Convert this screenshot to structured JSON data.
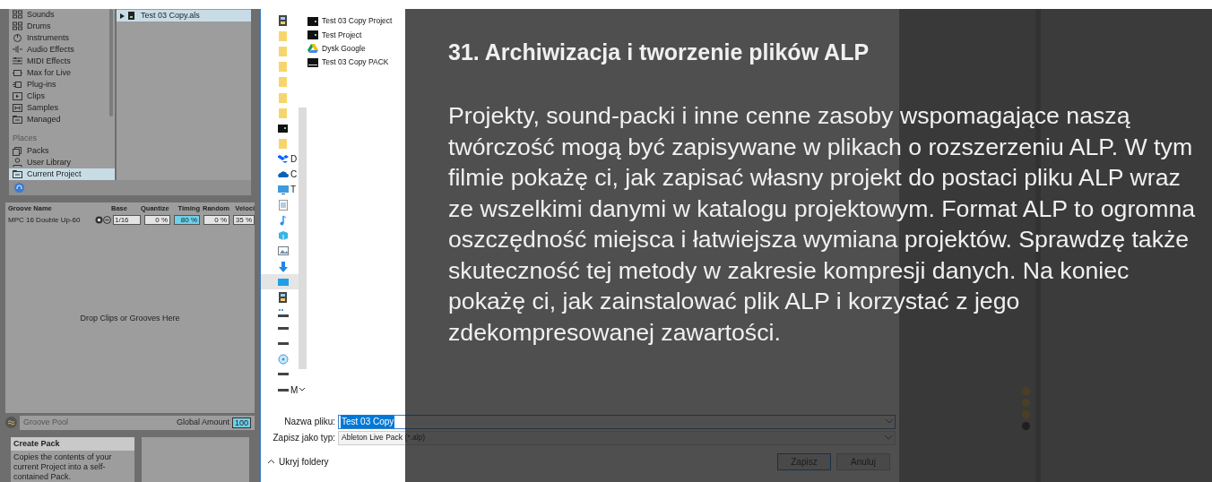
{
  "browser": {
    "categories": [
      {
        "label": "Sounds"
      },
      {
        "label": "Drums"
      },
      {
        "label": "Instruments"
      },
      {
        "label": "Audio Effects"
      },
      {
        "label": "MIDI Effects"
      },
      {
        "label": "Max for Live"
      },
      {
        "label": "Plug-ins"
      },
      {
        "label": "Clips"
      },
      {
        "label": "Samples"
      },
      {
        "label": "Managed"
      }
    ],
    "places_heading": "Places",
    "places": [
      {
        "label": "Packs",
        "selected": false
      },
      {
        "label": "User Library",
        "selected": false
      },
      {
        "label": "Current Project",
        "selected": true
      }
    ],
    "files": [
      {
        "label": "Test 03 Copy.als",
        "selected": true
      }
    ]
  },
  "groove_pool": {
    "columns": [
      "Groove Name",
      "Base",
      "Quantize",
      "Timing",
      "Random",
      "Veloci"
    ],
    "rows": [
      {
        "name": "MPC 16 Double Up-60",
        "base": "1/16",
        "quantize": "0 %",
        "timing": "80 %",
        "random": "0 %",
        "velocity": "35 %"
      }
    ],
    "drop_hint": "Drop Clips or Grooves Here",
    "footer_title": "Groove Pool",
    "global_amount_label": "Global Amount",
    "global_amount": "100"
  },
  "info_view": {
    "title": "Create Pack",
    "text": "Copies the contents of your current Project into a self-contained Pack."
  },
  "save_dialog": {
    "nav_items": [
      {
        "kind": "video",
        "selected": false
      },
      {
        "kind": "folder",
        "selected": false
      },
      {
        "kind": "folder",
        "selected": false
      },
      {
        "kind": "folder",
        "selected": false
      },
      {
        "kind": "folder",
        "selected": false
      },
      {
        "kind": "folder",
        "selected": false
      },
      {
        "kind": "folder",
        "selected": false
      },
      {
        "kind": "project",
        "selected": false
      },
      {
        "kind": "folder",
        "selected": false
      },
      {
        "kind": "dropbox",
        "label": "D",
        "selected": false
      },
      {
        "kind": "cloud",
        "label": "C",
        "selected": false
      },
      {
        "kind": "pc",
        "label": "T",
        "selected": false
      },
      {
        "kind": "document",
        "selected": false
      },
      {
        "kind": "music",
        "selected": false
      },
      {
        "kind": "cube",
        "selected": false
      },
      {
        "kind": "picture",
        "selected": false
      },
      {
        "kind": "download",
        "selected": false
      },
      {
        "kind": "desktop",
        "selected": true
      },
      {
        "kind": "video",
        "selected": false
      },
      {
        "kind": "netdrive",
        "selected": false
      },
      {
        "kind": "drive",
        "selected": false
      },
      {
        "kind": "drive",
        "selected": false
      },
      {
        "kind": "disc",
        "selected": false
      },
      {
        "kind": "drive",
        "selected": false
      },
      {
        "kind": "drive",
        "label": "M",
        "expandable": true,
        "selected": false
      }
    ],
    "files": [
      {
        "name": "Test 03 Copy Project",
        "kind": "project"
      },
      {
        "name": "Test Project",
        "kind": "project"
      },
      {
        "name": "Dysk Google",
        "kind": "gdrive"
      },
      {
        "name": "Test 03 Copy PACK",
        "kind": "pack"
      }
    ],
    "filename_label": "Nazwa pliku:",
    "filename": "Test 03 Copy",
    "filetype_label": "Zapisz jako typ:",
    "filetype": "Ableton Live Pack (*.alp)",
    "hide_folders": "Ukryj foldery",
    "buttons": [
      "Zapisz",
      "Anuluj"
    ]
  },
  "overlay": {
    "title": "31. Archiwizacja i tworzenie plików ALP",
    "description": "Projekty, sound-packi i inne cenne zasoby wspomagające naszą twórczość mogą być zapisywane w plikach o rozszerzeniu ALP. W tym filmie pokażę ci, jak zapisać własny projekt do postaci pliku ALP wraz ze wszelkimi danymi w katalogu projektowym. Format ALP to ogromna oszczędność miejsca i łatwiejsza wymiana projektów. Sprawdzę także skuteczność tej metody w zakresie kompresji danych. Na koniec pokażę ci, jak zainstalować plik ALP i korzystać z jego zdekompresowanej zawartości."
  }
}
